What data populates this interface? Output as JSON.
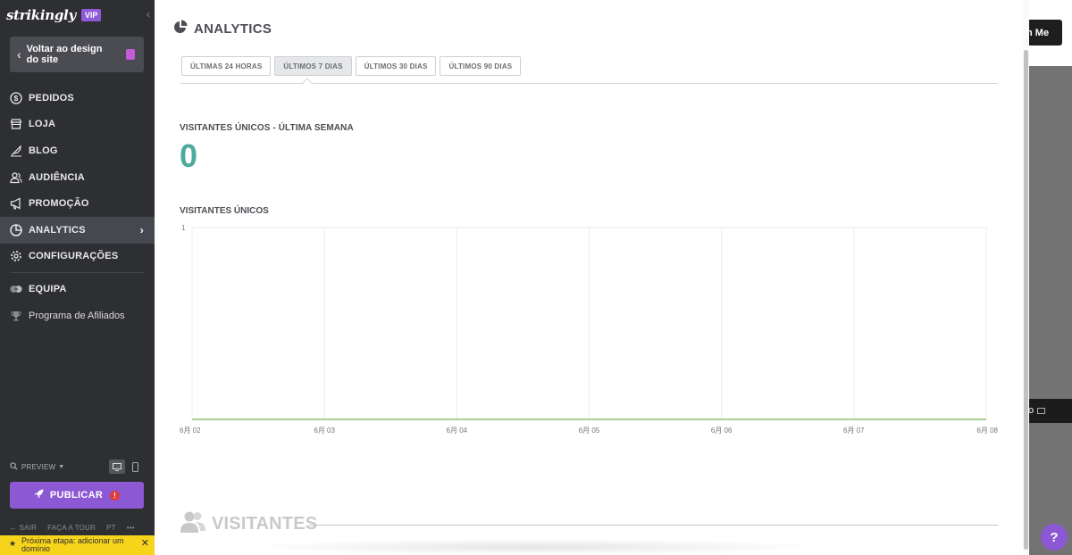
{
  "sidebar": {
    "logo": "strikingly",
    "vip": "VIP",
    "back_label": "Voltar ao design do site",
    "items": [
      {
        "label": "PEDIDOS",
        "icon": "dollar-circle-icon"
      },
      {
        "label": "LOJA",
        "icon": "store-icon"
      },
      {
        "label": "BLOG",
        "icon": "feather-icon"
      },
      {
        "label": "AUDIÊNCIA",
        "icon": "people-icon"
      },
      {
        "label": "PROMOÇÃO",
        "icon": "megaphone-icon"
      },
      {
        "label": "ANALYTICS",
        "icon": "pie-chart-icon",
        "active": true
      },
      {
        "label": "CONFIGURAÇÕES",
        "icon": "gear-icon"
      }
    ],
    "team_label": "EQUIPA",
    "affiliate_label": "Programa de Afiliados",
    "preview_label": "PREVIEW",
    "publish_label": "PUBLICAR",
    "publish_warning": "!",
    "bottom_links": {
      "exit": "SAIR",
      "tour": "FAÇA A TOUR",
      "lang": "PT",
      "more": "•••"
    },
    "next_step": "Próxima etapa: adicionar um domínio"
  },
  "main": {
    "title": "ANALYTICS",
    "tabs": [
      {
        "label": "ÚLTIMAS 24 HORAS",
        "active": false
      },
      {
        "label": "ÚLTIMOS 7 DIAS",
        "active": true
      },
      {
        "label": "ÚLTIMOS 30 DIAS",
        "active": false
      },
      {
        "label": "ÚLTIMOS 90 DIAS",
        "active": false
      }
    ],
    "unique_visitors_title": "VISITANTES ÚNICOS - ÚLTIMA SEMANA",
    "unique_visitors_value": "0",
    "chart_title": "VISITANTES ÚNICOS",
    "visitors_section": "VISITANTES"
  },
  "chart_data": {
    "type": "line",
    "title": "VISITANTES ÚNICOS",
    "x": [
      "6月 02",
      "6月 03",
      "6月 04",
      "6月 05",
      "6月 06",
      "6月 07",
      "6月 08"
    ],
    "series": [
      {
        "values": [
          0,
          0,
          0,
          0,
          0,
          0,
          0
        ]
      }
    ],
    "ylim": [
      0,
      1
    ],
    "y_tick_label": "1",
    "grid": true,
    "line_color": "#8cc06e"
  },
  "backdrop": {
    "button_label": "h Me",
    "dark_bar_label": "O"
  },
  "help_label": "?"
}
